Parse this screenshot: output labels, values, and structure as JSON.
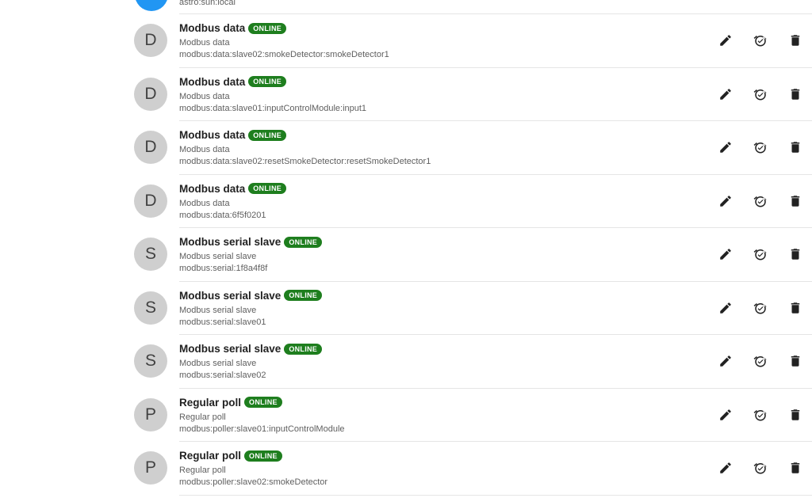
{
  "previous_item": {
    "uid": "astro:sun:local",
    "avatar_color": "#2196f3"
  },
  "status_color": "#1e7e1e",
  "items": [
    {
      "avatar": "D",
      "title": "Modbus data",
      "status": "ONLINE",
      "label": "Modbus data",
      "uid": "modbus:data:slave02:smokeDetector:smokeDetector1"
    },
    {
      "avatar": "D",
      "title": "Modbus data",
      "status": "ONLINE",
      "label": "Modbus data",
      "uid": "modbus:data:slave01:inputControlModule:input1"
    },
    {
      "avatar": "D",
      "title": "Modbus data",
      "status": "ONLINE",
      "label": "Modbus data",
      "uid": "modbus:data:slave02:resetSmokeDetector:resetSmokeDetector1"
    },
    {
      "avatar": "D",
      "title": "Modbus data",
      "status": "ONLINE",
      "label": "Modbus data",
      "uid": "modbus:data:6f5f0201"
    },
    {
      "avatar": "S",
      "title": "Modbus serial slave",
      "status": "ONLINE",
      "label": "Modbus serial slave",
      "uid": "modbus:serial:1f8a4f8f"
    },
    {
      "avatar": "S",
      "title": "Modbus serial slave",
      "status": "ONLINE",
      "label": "Modbus serial slave",
      "uid": "modbus:serial:slave01"
    },
    {
      "avatar": "S",
      "title": "Modbus serial slave",
      "status": "ONLINE",
      "label": "Modbus serial slave",
      "uid": "modbus:serial:slave02"
    },
    {
      "avatar": "P",
      "title": "Regular poll",
      "status": "ONLINE",
      "label": "Regular poll",
      "uid": "modbus:poller:slave01:inputControlModule"
    },
    {
      "avatar": "P",
      "title": "Regular poll",
      "status": "ONLINE",
      "label": "Regular poll",
      "uid": "modbus:poller:slave02:smokeDetector"
    }
  ],
  "actions": [
    "pencil-icon",
    "alarm-clock-icon",
    "trash-icon"
  ]
}
